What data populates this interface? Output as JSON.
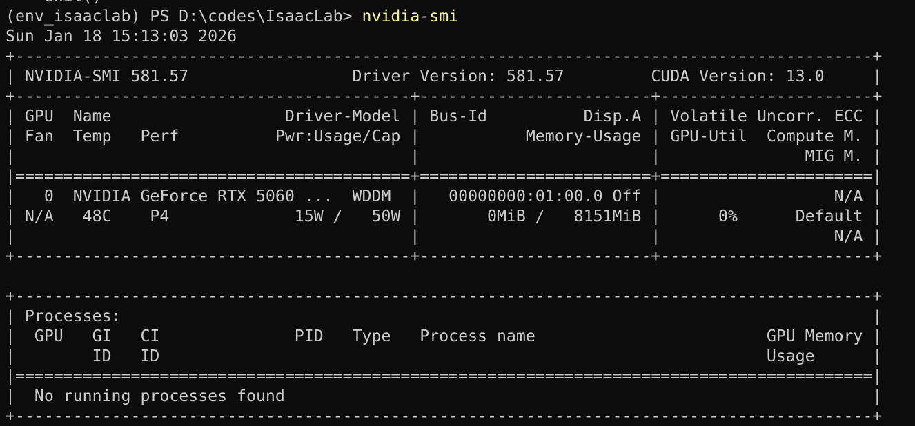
{
  "terminal": {
    "prev_line": "    exit()",
    "prompt": "(env_isaaclab) PS D:\\codes\\IsaacLab> ",
    "command": "nvidia-smi",
    "datetime": "Sun Jan 18 15:13:03 2026",
    "lines": [
      "+-----------------------------------------------------------------------------------------+",
      "| NVIDIA-SMI 581.57                 Driver Version: 581.57         CUDA Version: 13.0     |",
      "+-----------------------------------------+------------------------+----------------------+",
      "| GPU  Name                  Driver-Model | Bus-Id          Disp.A | Volatile Uncorr. ECC |",
      "| Fan  Temp   Perf          Pwr:Usage/Cap |           Memory-Usage | GPU-Util  Compute M. |",
      "|                                         |                        |               MIG M. |",
      "|=========================================+========================+======================|",
      "|   0  NVIDIA GeForce RTX 5060 ...  WDDM  |   00000000:01:00.0 Off |                  N/A |",
      "| N/A   48C    P4             15W /   50W |       0MiB /   8151MiB |      0%      Default |",
      "|                                         |                        |                  N/A |",
      "+-----------------------------------------+------------------------+----------------------+",
      "",
      "+-----------------------------------------------------------------------------------------+",
      "| Processes:                                                                              |",
      "|  GPU   GI   CI              PID   Type   Process name                        GPU Memory |",
      "|        ID   ID                                                               Usage      |",
      "|=========================================================================================|",
      "|  No running processes found                                                             |",
      "+-----------------------------------------------------------------------------------------+"
    ]
  }
}
